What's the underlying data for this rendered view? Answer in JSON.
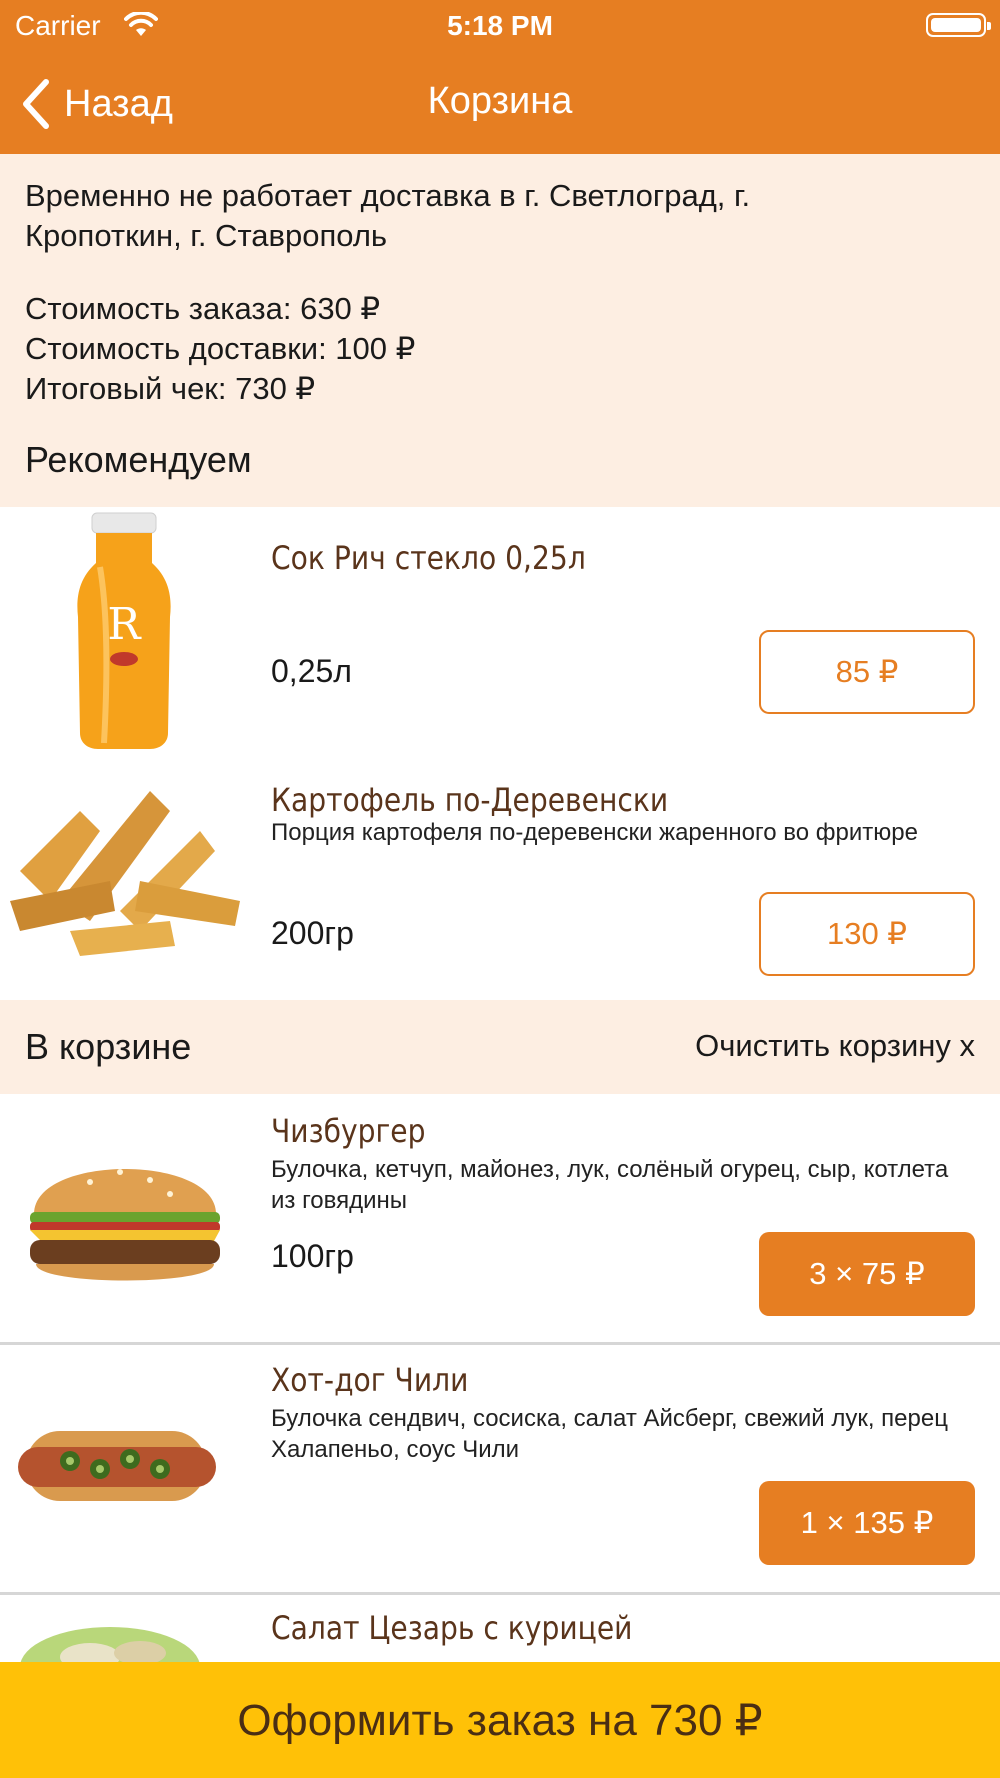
{
  "status_bar": {
    "carrier": "Carrier",
    "time": "5:18 PM"
  },
  "nav": {
    "back_label": "Назад",
    "title": "Корзина"
  },
  "info": {
    "notice": "Временно не работает доставка в г. Светлоград, г. Кропоткин, г. Ставрополь",
    "order_cost": "Стоимость заказа: 630 ₽",
    "delivery_cost": "Стоимость доставки: 100 ₽",
    "total": "Итоговый чек: 730 ₽",
    "recommend_title": "Рекомендуем"
  },
  "recommended": [
    {
      "name": "Сок Рич стекло 0,25л",
      "description": "",
      "weight": "0,25л",
      "price": "85 ₽",
      "icon": "juice-bottle-image"
    },
    {
      "name": "Картофель по-Деревенски",
      "description": "Порция картофеля по-деревенски жаренного во фритюре",
      "weight": "200гр",
      "price": "130 ₽",
      "icon": "potato-wedges-image"
    }
  ],
  "cart": {
    "title": "В корзине",
    "clear_label": "Очистить корзину x",
    "items": [
      {
        "name": "Чизбургер",
        "description": "Булочка, кетчуп, майонез, лук, солёный огурец, сыр, котлета из говядины",
        "weight": "100гр",
        "price": "3 × 75 ₽",
        "icon": "cheeseburger-image"
      },
      {
        "name": "Хот-дог Чили",
        "description": "Булочка сендвич, сосиска, салат Айсберг, свежий лук, перец Халапеньо, соус Чили",
        "weight": "",
        "price": "1 × 135 ₽",
        "icon": "hotdog-image"
      },
      {
        "name": "Салат Цезарь с курицей",
        "icon": "caesar-salad-image"
      }
    ]
  },
  "checkout": {
    "label": "Оформить заказ на 730 ₽"
  },
  "colors": {
    "accent": "#E67E22",
    "section_bg": "#FDEEE2",
    "checkout_bg": "#FFC107",
    "product_name": "#5A341B"
  }
}
